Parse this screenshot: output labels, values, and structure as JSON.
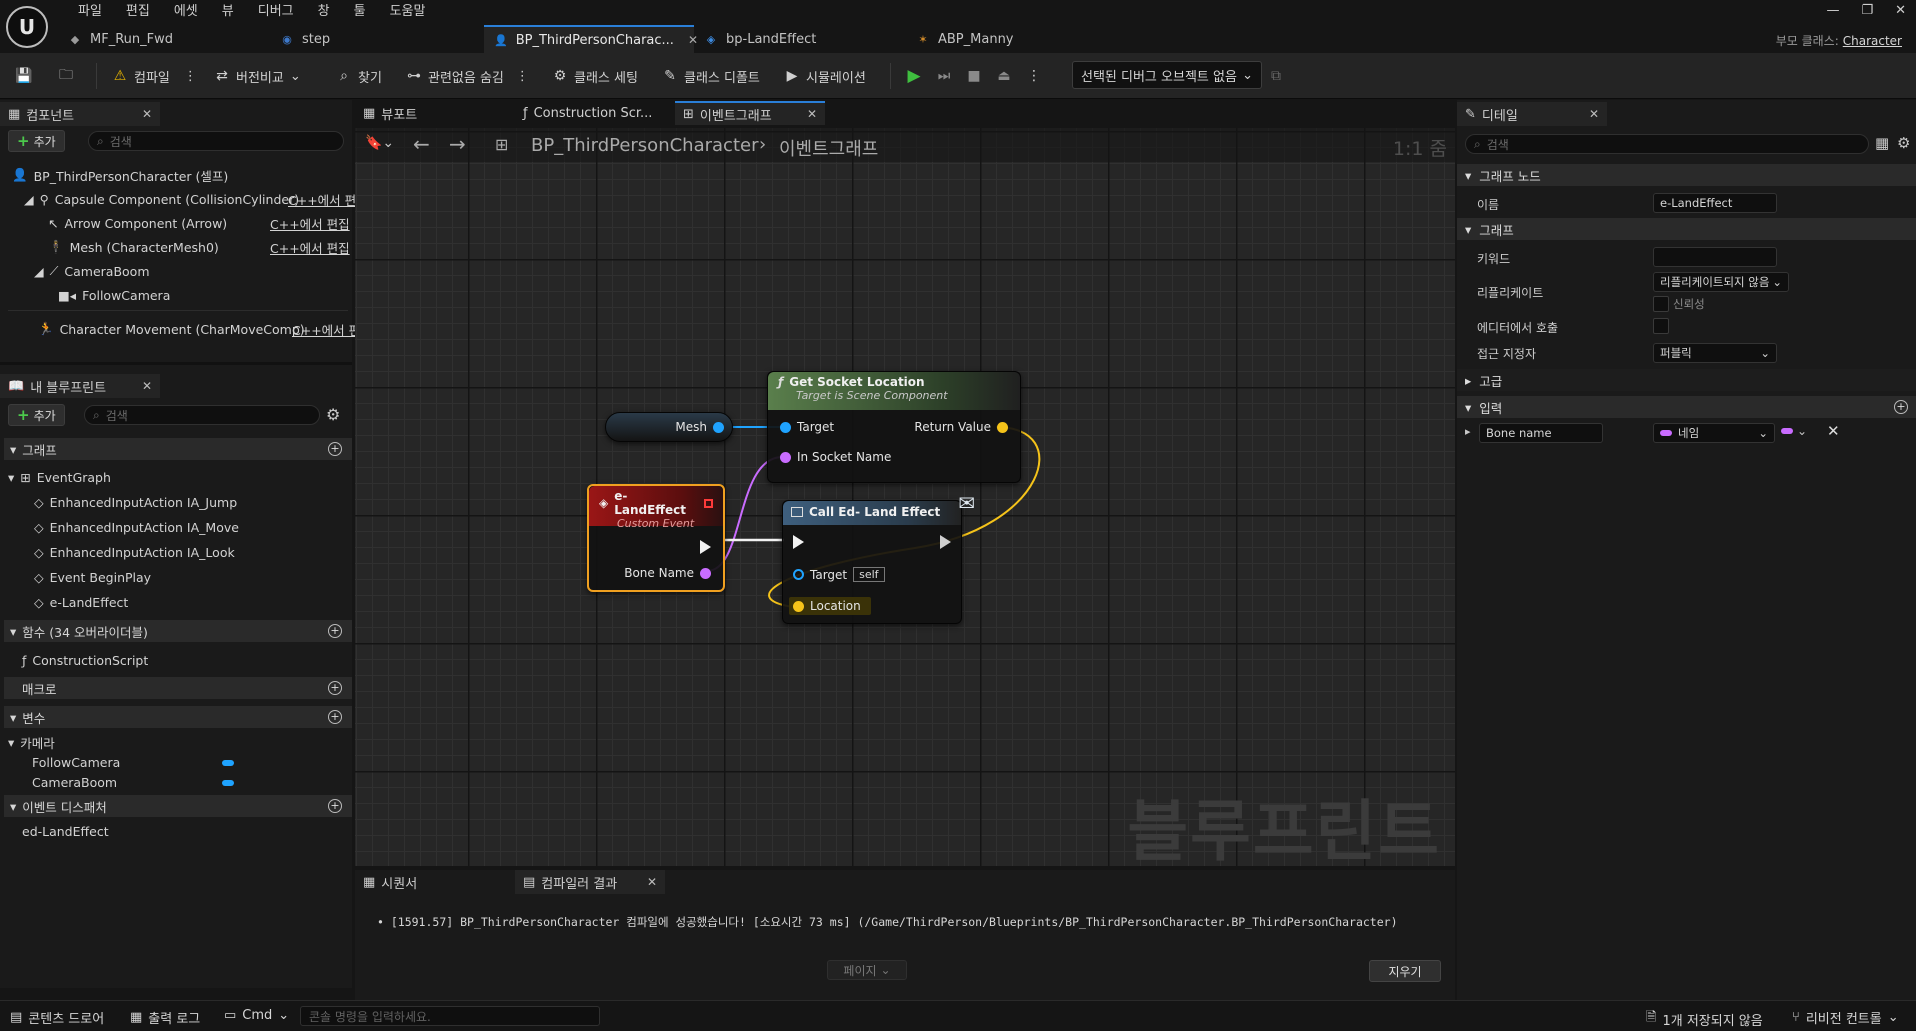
{
  "menu": [
    "파일",
    "편집",
    "에셋",
    "뷰",
    "디버그",
    "창",
    "툴",
    "도움말"
  ],
  "doc_tabs": [
    {
      "label": "MF_Run_Fwd",
      "icon": "material-function-icon"
    },
    {
      "label": "step",
      "icon": "sound-icon"
    },
    {
      "label": "BP_ThirdPersonCharac...",
      "icon": "character-icon",
      "active": true
    },
    {
      "label": "bp-LandEffect",
      "icon": "blueprint-icon"
    },
    {
      "label": "ABP_Manny",
      "icon": "anim-blueprint-icon"
    }
  ],
  "parent_class": {
    "label": "부모 클래스:",
    "value": "Character"
  },
  "toolbar": {
    "compile": "컴파일",
    "diff": "버전비교",
    "find": "찾기",
    "hide_unrelated": "관련없음 숨김",
    "class_settings": "클래스 세팅",
    "class_defaults": "클래스 디폴트",
    "simulation": "시뮬레이션",
    "debug_object": "선택된 디버그 오브젝트 없음"
  },
  "components": {
    "tab_title": "컴포넌트",
    "add": "추가",
    "search_placeholder": "검색",
    "root": "BP_ThirdPersonCharacter (셀프)",
    "items": [
      {
        "label": "Capsule Component (CollisionCylinder)",
        "edit": "C++에서 편"
      },
      {
        "label": "Arrow Component (Arrow)",
        "edit": "C++에서 편집"
      },
      {
        "label": "Mesh (CharacterMesh0)",
        "edit": "C++에서 편집"
      },
      {
        "label": "CameraBoom",
        "edit": ""
      },
      {
        "label": "FollowCamera",
        "edit": ""
      },
      {
        "label": "Character Movement (CharMoveComp)",
        "edit": "C++에서 편"
      }
    ]
  },
  "my_blueprint": {
    "tab_title": "내 블루프린트",
    "add": "추가",
    "search_placeholder": "검색",
    "graph_section": "그래프",
    "event_graph": "EventGraph",
    "events": [
      "EnhancedInputAction IA_Jump",
      "EnhancedInputAction IA_Move",
      "EnhancedInputAction IA_Look",
      "Event BeginPlay",
      "e-LandEffect"
    ],
    "functions_section": "함수 (34 오버라이더블)",
    "functions": [
      "ConstructionScript"
    ],
    "macros_section": "매크로",
    "variables_section": "변수",
    "variable_category": "카메라",
    "variables": [
      "FollowCamera",
      "CameraBoom"
    ],
    "dispatchers_section": "이벤트 디스패처",
    "dispatchers": [
      "ed-LandEffect"
    ]
  },
  "center_tabs": [
    "뷰포트",
    "Construction Scr...",
    "이벤트그래프"
  ],
  "breadcrumb": {
    "root": "BP_ThirdPersonCharacter",
    "current": "이벤트그래프"
  },
  "zoom": "1:1 줌",
  "watermark": "블루프린트",
  "nodes": {
    "mesh": {
      "label": "Mesh"
    },
    "socket": {
      "title": "Get Socket Location",
      "subtitle": "Target is Scene Component",
      "target": "Target",
      "return": "Return Value",
      "socket_name": "In Socket Name"
    },
    "event": {
      "title": "e-LandEffect",
      "subtitle": "Custom Event",
      "bone": "Bone Name"
    },
    "call": {
      "title": "Call Ed- Land Effect",
      "target": "Target",
      "target_value": "self",
      "location": "Location"
    }
  },
  "bottom": {
    "tabs": [
      "시퀀서",
      "컴파일러 결과"
    ],
    "log": "[1591.57] BP_ThirdPersonCharacter 컴파일에 성공했습니다! [소요시간 73 ms] (/Game/ThirdPerson/Blueprints/BP_ThirdPersonCharacter.BP_ThirdPersonCharacter)",
    "page": "페이지",
    "clear": "지우기"
  },
  "details": {
    "tab_title": "디테일",
    "search_placeholder": "검색",
    "graph_node_section": "그래프 노드",
    "name_label": "이름",
    "name_value": "e-LandEffect",
    "graph_section": "그래프",
    "keywords_label": "키워드",
    "replicate_label": "리플리케이트",
    "replicate_value": "리플리케이트되지 않음",
    "reliable_label": "신뢰성",
    "call_in_editor_label": "에디터에서 호출",
    "access_label": "접근 지정자",
    "access_value": "퍼블릭",
    "advanced_section": "고급",
    "inputs_section": "입력",
    "input_name": "Bone name",
    "input_type": "네임"
  },
  "statusbar": {
    "content_drawer": "콘텐츠 드로어",
    "output_log": "출력 로그",
    "cmd": "Cmd",
    "console_placeholder": "콘솔 명령을 입력하세요.",
    "unsaved": "1개 저장되지 않음",
    "revision": "리비전 컨트롤"
  },
  "colors": {
    "accent": "#2a7fd8",
    "object_pin": "#1fa3ff",
    "name_pin": "#c96cff",
    "vector_pin": "#f5c31a",
    "event_header": "#8a1414",
    "pure_header": "#4f6b45",
    "call_header": "#3b5a78"
  }
}
